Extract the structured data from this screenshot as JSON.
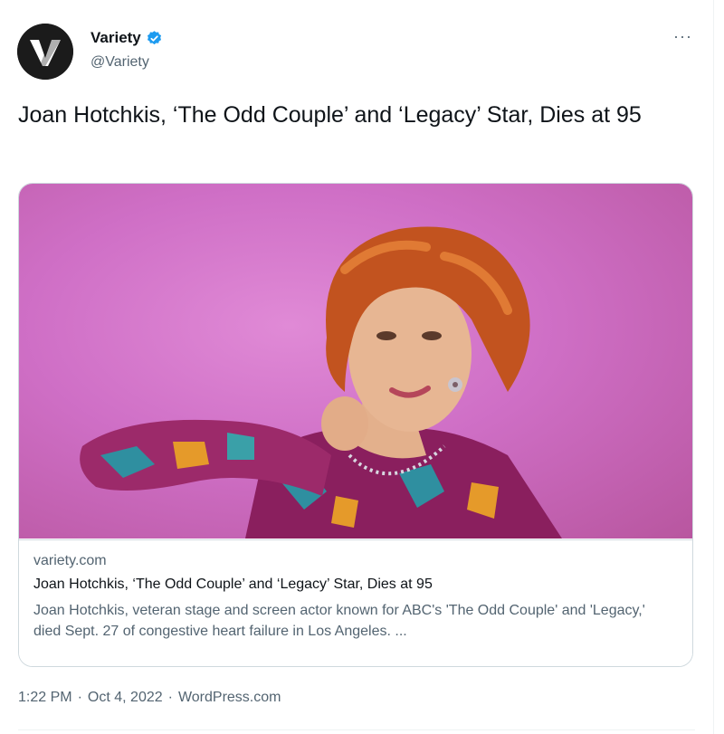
{
  "author": {
    "display_name": "Variety",
    "handle": "@Variety",
    "avatar_letter": "V",
    "verified": true
  },
  "menu": {
    "more_label": "···"
  },
  "tweet": {
    "text": "Joan Hotchkis, ‘The Odd Couple’ and ‘Legacy’ Star, Dies at 95"
  },
  "card": {
    "domain": "variety.com",
    "title": "Joan Hotchkis, ‘The Odd Couple’ and ‘Legacy’ Star, Dies at 95",
    "description": "Joan Hotchkis, veteran stage and screen actor known for ABC's 'The Odd Couple' and 'Legacy,' died Sept. 27 of congestive heart failure in Los Angeles. ..."
  },
  "meta": {
    "time": "1:22 PM",
    "separator": "·",
    "date": "Oct 4, 2022",
    "source": "WordPress.com"
  },
  "colors": {
    "verified_blue": "#1d9bf0",
    "muted_text": "#536471",
    "primary_text": "#0f1419",
    "card_bg_pink": "#cf6fc6"
  }
}
